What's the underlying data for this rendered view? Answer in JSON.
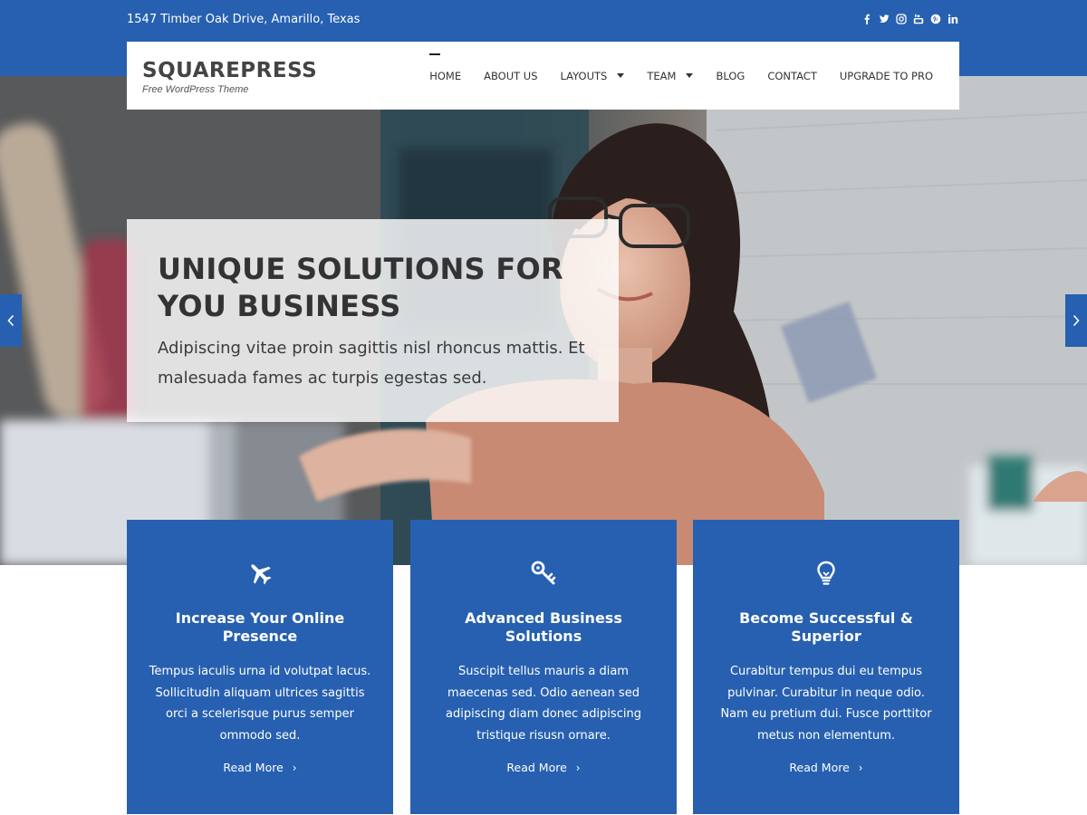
{
  "topbar": {
    "address": "1547 Timber Oak Drive, Amarillo, Texas",
    "socials": [
      "facebook-icon",
      "twitter-icon",
      "instagram-icon",
      "youtube-icon",
      "pinterest-icon",
      "linkedin-icon"
    ]
  },
  "header": {
    "site_title": "SQUAREPRESS",
    "tagline": "Free WordPress Theme"
  },
  "nav": {
    "items": [
      {
        "label": "HOME",
        "active": true,
        "dropdown": false
      },
      {
        "label": "ABOUT US",
        "active": false,
        "dropdown": false
      },
      {
        "label": "LAYOUTS",
        "active": false,
        "dropdown": true
      },
      {
        "label": "TEAM",
        "active": false,
        "dropdown": true
      },
      {
        "label": "BLOG",
        "active": false,
        "dropdown": false
      },
      {
        "label": "CONTACT",
        "active": false,
        "dropdown": false
      },
      {
        "label": "UPGRADE TO PRO",
        "active": false,
        "dropdown": false
      }
    ]
  },
  "hero": {
    "title": "UNIQUE SOLUTIONS FOR YOU BUSINESS",
    "text": "Adipiscing vitae proin sagittis nisl rhoncus mattis. Et malesuada fames ac turpis egestas sed."
  },
  "features": [
    {
      "icon": "plane-icon",
      "title": "Increase Your Online Presence",
      "text": "Tempus iaculis urna id volutpat lacus. Sollicitudin aliquam ultrices sagittis orci a scelerisque purus semper ommodo sed.",
      "link": "Read More"
    },
    {
      "icon": "key-icon",
      "title": "Advanced Business Solutions",
      "text": "Suscipit tellus mauris a diam maecenas sed. Odio aenean sed adipiscing diam donec adipiscing tristique risusn ornare.",
      "link": "Read More"
    },
    {
      "icon": "lightbulb-icon",
      "title": "Become Successful & Superior",
      "text": "Curabitur tempus dui eu tempus pulvinar. Curabitur in neque odio. Nam eu pretium dui. Fusce porttitor metus non elementum.",
      "link": "Read More"
    }
  ],
  "colors": {
    "brand_blue": "#2760b0",
    "white": "#ffffff",
    "text_dark": "#333333"
  }
}
